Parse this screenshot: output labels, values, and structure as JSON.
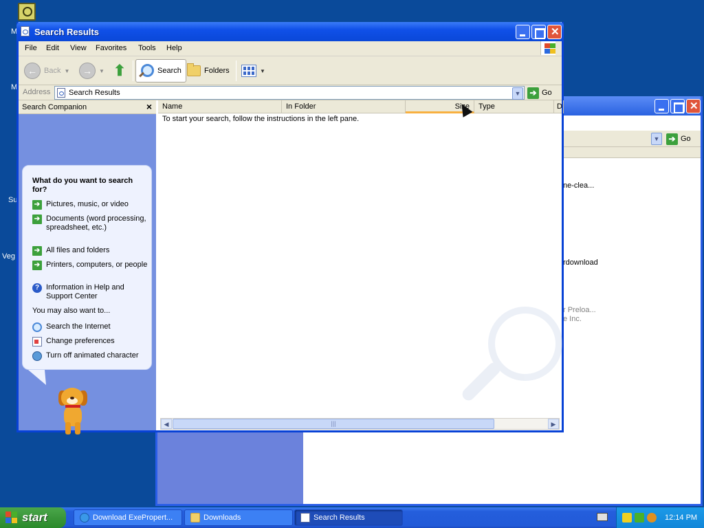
{
  "desktop": {
    "fragments": [
      "M",
      "M",
      "Su",
      "Veg"
    ]
  },
  "background_window": {
    "go_label": "Go",
    "files": [
      "ne-clea...",
      "rdownload",
      "r Preloa...",
      "e Inc."
    ]
  },
  "window": {
    "title": "Search Results",
    "menu": [
      "File",
      "Edit",
      "View",
      "Favorites",
      "Tools",
      "Help"
    ],
    "toolbar": {
      "back": "Back",
      "search": "Search",
      "folders": "Folders"
    },
    "address": {
      "label": "Address",
      "value": "Search Results",
      "go_label": "Go"
    },
    "search_companion": {
      "header": "Search Companion",
      "question": "What do you want to search for?",
      "options": [
        "Pictures, music, or video",
        "Documents (word processing, spreadsheet, etc.)",
        "All files and folders",
        "Printers, computers, or people",
        "Information in Help and Support Center"
      ],
      "also_label": "You may also want to...",
      "also_options": [
        "Search the Internet",
        "Change preferences",
        "Turn off animated character"
      ]
    },
    "columns": [
      "Name",
      "In Folder",
      "Size",
      "Type",
      "D"
    ],
    "empty_message": "To start your search, follow the instructions in the left pane."
  },
  "taskbar": {
    "start_label": "start",
    "tasks": [
      "Download ExePropert...",
      "Downloads",
      "Search Results"
    ],
    "clock": "12:14 PM"
  },
  "colors": {
    "desktop": "#0a4a9a",
    "titlebar": "#0a48d8",
    "start": "#3a963a",
    "taskbar": "#225ad8",
    "tray": "#1286d8"
  }
}
